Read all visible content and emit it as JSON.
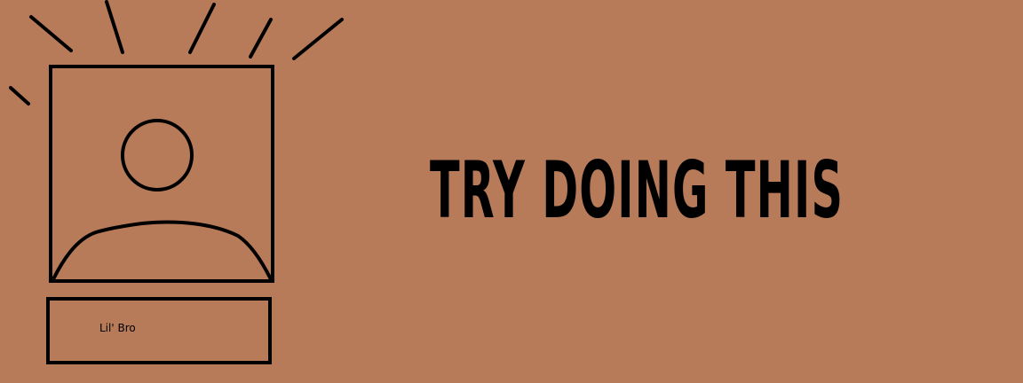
{
  "profile": {
    "name": "Lil' Bro"
  },
  "headline": "TRY DOING THIS",
  "colors": {
    "background": "#b87b59",
    "ink": "#000000"
  },
  "icons": {
    "avatar": "person-silhouette-icon",
    "rays": "sparkle-rays-icon"
  }
}
